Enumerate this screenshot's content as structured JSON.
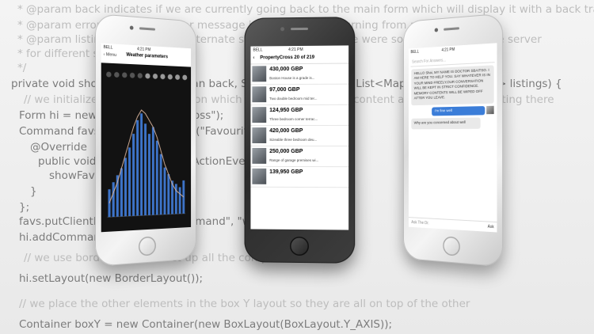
{
  "code_lines": [
    {
      "text": "* @param back indicates if we are currently going back to the main form which will display it with a back transition",
      "cls": "c"
    },
    {
      "text": "* @param errorMessage an error message in case we are returning from a search error",
      "cls": "c"
    },
    {
      "text": "* @param listings the listing of alternate spellings in case there were some errors from the server",
      "cls": "c"
    },
    {
      "text": "* for different spellings",
      "cls": "c"
    },
    {
      "text": "*/",
      "cls": "c"
    },
    {
      "text": "private void showMainForm(boolean back, String errorMessage, List<Map<String, Object>> listings) {",
      "cls": ""
    },
    {
      "text": "// we initialize the favorites button which shows the favorites content and initialize the listing there",
      "cls": "c"
    },
    {
      "text": "Form hi = new Form(\"PropertyCross\");",
      "cls": ""
    },
    {
      "text": "Command favs = new Command(\"Favourites\") {",
      "cls": ""
    },
    {
      "text": "@Override",
      "cls": ""
    },
    {
      "text": "public void actionPerformed(ActionEvent ev) {",
      "cls": ""
    },
    {
      "text": "showFavs();",
      "cls": ""
    },
    {
      "text": "}",
      "cls": ""
    },
    {
      "text": "};",
      "cls": ""
    },
    {
      "text": "favs.putClientProperty(\"TitleCommand\", \"with\");",
      "cls": ""
    },
    {
      "text": "hi.addCommand(favs);",
      "cls": ""
    },
    {
      "text": "// we use border layout to set up all the components",
      "cls": "c"
    },
    {
      "text": "hi.setLayout(new BorderLayout());",
      "cls": ""
    },
    {
      "text": "// we place the other elements in the box Y layout so they are all on top of the other",
      "cls": "c"
    },
    {
      "text": "Container boxY = new Container(new BoxLayout(BoxLayout.Y_AXIS));",
      "cls": ""
    }
  ],
  "weather": {
    "status_carrier": "BELL",
    "status_time": "4:21 PM",
    "back_label": "Menu",
    "title": "Weather parameters",
    "chart_data": {
      "type": "bar",
      "values": [
        8,
        10,
        12,
        14,
        17,
        20,
        24,
        28,
        30,
        27,
        24,
        26,
        22,
        18,
        14,
        12,
        10,
        9,
        8,
        10
      ],
      "line": [
        4,
        7,
        10,
        14,
        18,
        22,
        26,
        29,
        31,
        30,
        28,
        26,
        23,
        19,
        15,
        12,
        9,
        7,
        6,
        5
      ],
      "ylim": [
        0,
        35
      ],
      "bar_color": "#3d74c9",
      "line_color": "#d8b39a"
    }
  },
  "property": {
    "status_carrier": "BELL",
    "status_time": "4:21 PM",
    "back_label": "PropertyCross",
    "title_count": "20 of 219",
    "listings": [
      {
        "price": "430,000 GBP",
        "desc": "Boston House is a grade is..."
      },
      {
        "price": "97,000 GBP",
        "desc": "Two double bedroom mid ter..."
      },
      {
        "price": "124,950 GBP",
        "desc": "Three bedroom corner terrac..."
      },
      {
        "price": "420,000 GBP",
        "desc": "Sizeable three bedroom deu..."
      },
      {
        "price": "250,000 GBP",
        "desc": "Range of garage premises wi..."
      },
      {
        "price": "139,950 GBP",
        "desc": ""
      }
    ]
  },
  "chat": {
    "status_carrier": "BELL",
    "status_time": "4:21 PM",
    "search_placeholder": "Search For Answers...",
    "greeting": "HELLO Shai, MY NAME IS DOCTOR SBAITSO. I AM HERE TO HELP YOU. SAY WHATEVER IS IN YOUR MIND FREELY,OUR CONVERSATION WILL BE KEPT IN STRICT CONFIDENCE. MEMORY CONTENTS WILL BE WIPED OFF AFTER YOU LEAVE.",
    "user_msg": "I'm fine well",
    "reply": "Why are you concerned about well",
    "input_placeholder": "Ask The Dr.",
    "ask_label": "Ask"
  }
}
